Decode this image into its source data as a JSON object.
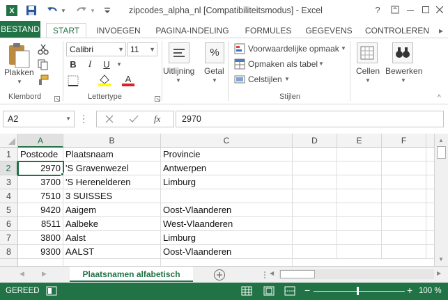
{
  "window": {
    "title": "zipcodes_alpha_nl  [Compatibiliteitsmodus] - Excel",
    "help": "?"
  },
  "tabs": [
    "BESTAND",
    "START",
    "INVOEGEN",
    "PAGINA-INDELING",
    "FORMULES",
    "GEGEVENS",
    "CONTROLEREN"
  ],
  "ribbon": {
    "paste_label": "Plakken",
    "clipboard_group": "Klembord",
    "font_name": "Calibri",
    "font_size": "11",
    "bold": "B",
    "italic": "I",
    "underline": "U",
    "font_group": "Lettertype",
    "alignment_label": "Uitlijning",
    "number_label": "Getal",
    "number_symbol": "%",
    "conditional_format": "Voorwaardelijke opmaak",
    "format_as_table": "Opmaken als tabel",
    "cell_styles": "Celstijlen",
    "styles_group": "Stijlen",
    "cells_label": "Cellen",
    "edit_label": "Bewerken"
  },
  "formula_bar": {
    "name_box": "A2",
    "fx": "fx",
    "value": "2970"
  },
  "columns": [
    "A",
    "B",
    "C",
    "D",
    "E",
    "F"
  ],
  "rows": [
    {
      "num": "1",
      "a": "Postcode",
      "b": "Plaatsnaam",
      "c": "Provincie"
    },
    {
      "num": "2",
      "a": "2970",
      "b": "'S Gravenwezel",
      "c": "Antwerpen"
    },
    {
      "num": "3",
      "a": "3700",
      "b": "'S Herenelderen",
      "c": "Limburg"
    },
    {
      "num": "4",
      "a": "7510",
      "b": "3 SUISSES",
      "c": ""
    },
    {
      "num": "5",
      "a": "9420",
      "b": "Aaigem",
      "c": "Oost-Vlaanderen"
    },
    {
      "num": "6",
      "a": "8511",
      "b": "Aalbeke",
      "c": "West-Vlaanderen"
    },
    {
      "num": "7",
      "a": "3800",
      "b": "Aalst",
      "c": "Limburg"
    },
    {
      "num": "8",
      "a": "9300",
      "b": "AALST",
      "c": "Oost-Vlaanderen"
    }
  ],
  "sheet": {
    "tab_name": "Plaatsnamen alfabetisch"
  },
  "status": {
    "ready": "GEREED",
    "zoom": "100 %"
  },
  "colors": {
    "accent": "#217346"
  }
}
